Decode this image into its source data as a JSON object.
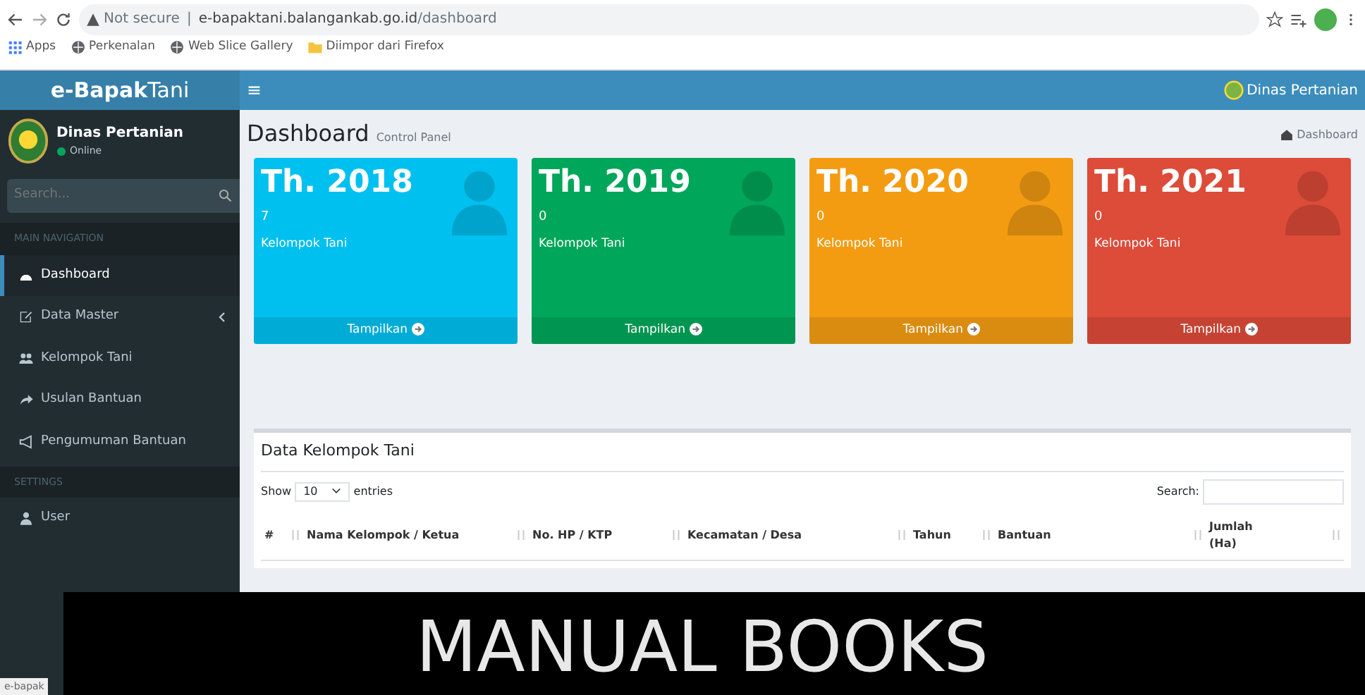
{
  "browser": {
    "url_warning": "Not secure",
    "url_separator": "|",
    "url_host": "e-bapaktani.balangankab.go.id",
    "url_path": "/dashboard",
    "bookmarks": [
      {
        "label": "Apps",
        "kind": "apps"
      },
      {
        "label": "Perkenalan",
        "kind": "globe"
      },
      {
        "label": "Web Slice Gallery",
        "kind": "globe"
      },
      {
        "label": "Diimpor dari Firefox",
        "kind": "folder"
      }
    ]
  },
  "header": {
    "logo_bold": "e-Bapak",
    "logo_light": "Tani",
    "menu_glyph": "≡",
    "user": "Dinas Pertanian"
  },
  "sidebar": {
    "user_name": "Dinas Pertanian",
    "status": "Online",
    "search_placeholder": "Search...",
    "sections": [
      {
        "header": "MAIN NAVIGATION",
        "items": [
          {
            "label": "Dashboard",
            "kind": "dashboard",
            "selected": true,
            "has_children": false
          },
          {
            "label": "Data Master",
            "kind": "edit",
            "selected": false,
            "has_children": true
          },
          {
            "label": "Kelompok Tani",
            "kind": "users",
            "selected": false,
            "has_children": false
          },
          {
            "label": "Usulan Bantuan",
            "kind": "share",
            "selected": false,
            "has_children": false
          },
          {
            "label": "Pengumuman Bantuan",
            "kind": "bullhorn",
            "selected": false,
            "has_children": false
          }
        ]
      },
      {
        "header": "SETTINGS",
        "items": [
          {
            "label": "User",
            "kind": "user",
            "selected": false,
            "has_children": false
          }
        ]
      }
    ]
  },
  "page": {
    "title": "Dashboard",
    "subtitle": "Control Panel",
    "breadcrumb": "Dashboard"
  },
  "stat_boxes": [
    {
      "title": "Th. 2018",
      "count": "7",
      "label": "Kelompok Tani",
      "link": "Tampilkan",
      "color": "#00c0ef"
    },
    {
      "title": "Th. 2019",
      "count": "0",
      "label": "Kelompok Tani",
      "link": "Tampilkan",
      "color": "#00a65a"
    },
    {
      "title": "Th. 2020",
      "count": "0",
      "label": "Kelompok Tani",
      "link": "Tampilkan",
      "color": "#f39c12"
    },
    {
      "title": "Th. 2021",
      "count": "0",
      "label": "Kelompok Tani",
      "link": "Tampilkan",
      "color": "#dd4b39"
    }
  ],
  "table_box": {
    "title": "Data Kelompok Tani",
    "show_label": "Show",
    "page_size": "10",
    "entries_label": "entries",
    "search_label": "Search:",
    "columns": [
      "#",
      "Nama Kelompok / Ketua",
      "No. HP / KTP",
      "Kecamatan / Desa",
      "Tahun",
      "Bantuan",
      "Jumlah (Ha)"
    ]
  },
  "status_bar": "e-bapak",
  "banner": {
    "text": "MANUAL BOOKS"
  }
}
